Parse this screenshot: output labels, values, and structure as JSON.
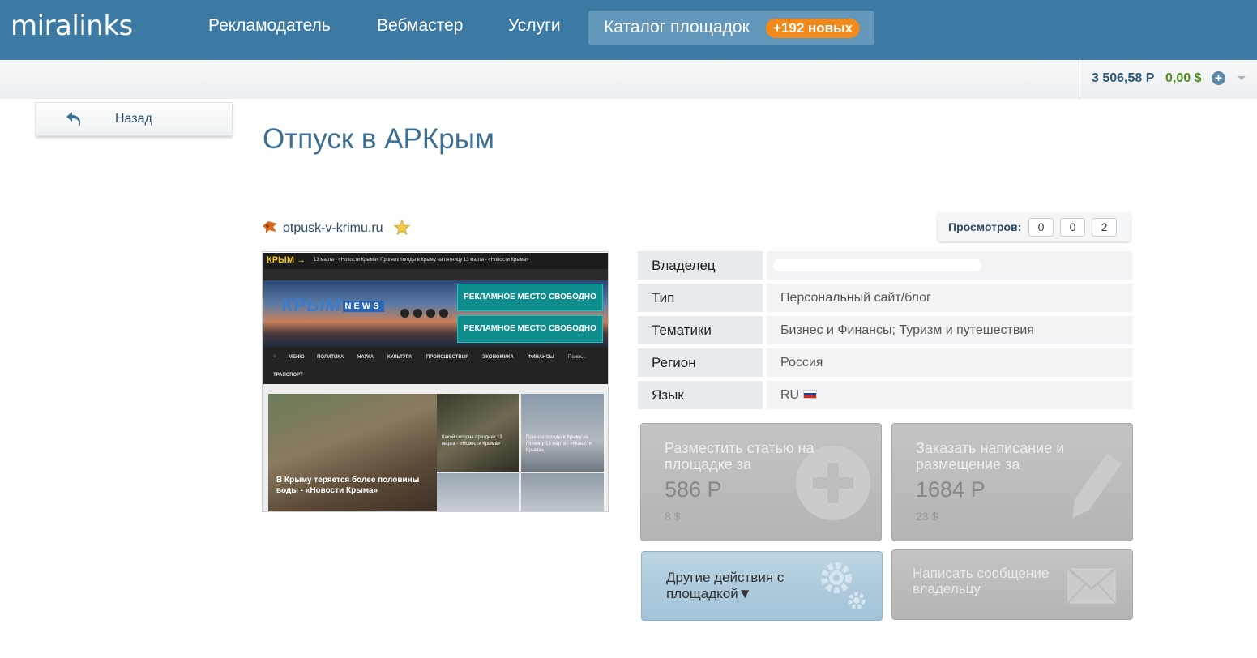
{
  "header": {
    "logo": "miralinks",
    "nav": [
      "Рекламодатель",
      "Вебмастер",
      "Услуги"
    ],
    "catalog_label": "Каталог площадок",
    "catalog_badge": "+192 новых"
  },
  "balance": {
    "rub": "3 506,58 Р",
    "usd": "0,00 $",
    "add": "+"
  },
  "back_label": "Назад",
  "title": "Отпуск в АРКрым",
  "site": {
    "url": "otpusk-v-krimu.ru"
  },
  "views": {
    "label": "Просмотров:",
    "values": [
      "0",
      "0",
      "2"
    ]
  },
  "preview": {
    "brand": "КРЫМ →",
    "ticker": "13 марта - «Новости Крыма»   Прогноз погоды в Крыму на пятницу 13 марта - «Новости Крыма»",
    "news_word": "КРЫМ",
    "news_tag": "NEWS",
    "ad1": "РЕКЛАМНОЕ  МЕСТО СВОБОДНО",
    "ad2": "РЕКЛАМНОЕ  МЕСТО СВОБОДНО",
    "menu": [
      "МЕНЮ",
      "ПОЛИТИКА",
      "НАУКА",
      "КУЛЬТУРА",
      "ПРОИСШЕСТВИЯ",
      "ЭКОНОМИКА",
      "ФИНАНСЫ",
      "Поиск..."
    ],
    "menu2": "ТРАНСПОРТ",
    "main_caption": "В Крыму теряется более половины воды - «Новости Крыма»",
    "card1": "Какой сегодня праздник 13 марта - «Новости Крыма»",
    "card2": "Прогноз погоды в Крыму на пятницу 13 марта - «Новости Крыма»"
  },
  "info": [
    {
      "key": "Владелец",
      "value": ""
    },
    {
      "key": "Тип",
      "value": "Персональный сайт/блог"
    },
    {
      "key": "Тематики",
      "value": "Бизнес и Финансы; Туризм и путешествия"
    },
    {
      "key": "Регион",
      "value": "Россия"
    },
    {
      "key": "Язык",
      "value": "RU"
    }
  ],
  "actions": {
    "place": {
      "title": "Разместить статью на площадке за",
      "price": "586 Р",
      "usd": "8 $"
    },
    "order": {
      "title": "Заказать написание и размещение за",
      "price": "1684 Р",
      "usd": "23 $"
    },
    "other": {
      "title": "Другие действия с площадкой▼"
    },
    "message": {
      "title": "Написать сообщение владельцу"
    }
  },
  "colors": {
    "nav_bg": "#3c7aa3",
    "badge": "#f18a1b",
    "title": "#3c6e90",
    "usd_green": "#4e8f1f"
  }
}
